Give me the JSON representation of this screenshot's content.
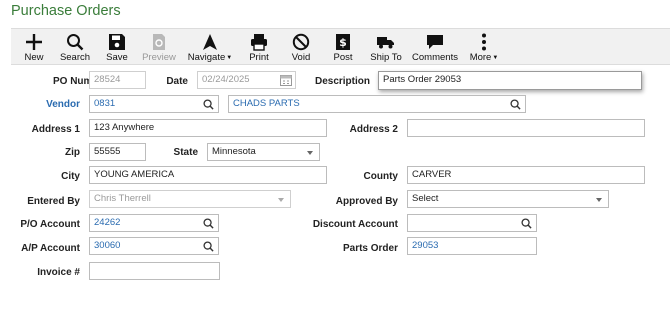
{
  "title": "Purchase Orders",
  "toolbar": {
    "new": "New",
    "search": "Search",
    "save": "Save",
    "preview": "Preview",
    "navigate": "Navigate",
    "print": "Print",
    "void": "Void",
    "post": "Post",
    "ship_to": "Ship To",
    "comments": "Comments",
    "more": "More"
  },
  "form": {
    "po_number": {
      "label": "PO Number",
      "value": "28524"
    },
    "date": {
      "label": "Date",
      "value": "02/24/2025"
    },
    "description": {
      "label": "Description",
      "value": "Parts Order 29053"
    },
    "vendor": {
      "label": "Vendor",
      "code": "0831",
      "name": "CHADS PARTS"
    },
    "address1": {
      "label": "Address 1",
      "value": "123 Anywhere"
    },
    "address2": {
      "label": "Address 2",
      "value": ""
    },
    "zip": {
      "label": "Zip",
      "value": "55555"
    },
    "state": {
      "label": "State",
      "value": "Minnesota"
    },
    "city": {
      "label": "City",
      "value": "YOUNG AMERICA"
    },
    "county": {
      "label": "County",
      "value": "CARVER"
    },
    "entered_by": {
      "label": "Entered By",
      "value": "Chris Therrell"
    },
    "approved_by": {
      "label": "Approved By",
      "value": "Select"
    },
    "po_account": {
      "label": "P/O Account",
      "value": "24262"
    },
    "discount_account": {
      "label": "Discount Account",
      "value": ""
    },
    "ap_account": {
      "label": "A/P Account",
      "value": "30060"
    },
    "parts_order": {
      "label": "Parts Order",
      "value": "29053"
    },
    "invoice": {
      "label": "Invoice #",
      "value": ""
    }
  },
  "colors": {
    "title": "#3a7d3a",
    "link": "#2a6bb0",
    "toolbar_bg": "#f1f1f1"
  }
}
